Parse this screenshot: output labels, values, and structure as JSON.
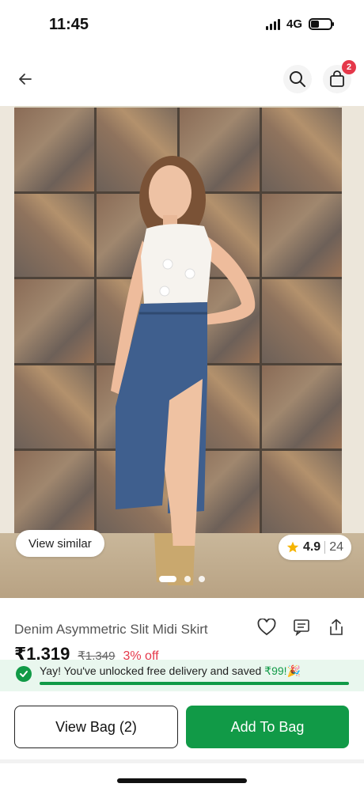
{
  "status_bar": {
    "time": "11:45",
    "network": "4G",
    "signal_bars": 4,
    "battery_level": 0.4
  },
  "header": {
    "back_icon": "arrow-left-icon",
    "search_icon": "search-icon",
    "bag_icon": "shopping-bag-icon",
    "bag_count": "2"
  },
  "gallery": {
    "view_similar_label": "View similar",
    "rating": "4.9",
    "rating_count": "24",
    "image_count": 3,
    "active_index": 0
  },
  "product": {
    "name": "Denim Asymmetric Slit Midi Skirt",
    "price": "₹1,319",
    "mrp": "₹1,349",
    "discount": "3% off",
    "action_icons": [
      "heart-icon",
      "chat-icon",
      "share-icon"
    ]
  },
  "delivery": {
    "message": "Yay! You've unlocked free delivery and saved ",
    "saved_amount": "₹99!",
    "emoji": "🎉",
    "progress": 1.0
  },
  "actions": {
    "view_bag_label": "View Bag (2)",
    "add_to_bag_label": "Add To Bag"
  },
  "colors": {
    "accent_green": "#119a47",
    "discount_red": "#e5384a",
    "star_yellow": "#f5b400"
  }
}
